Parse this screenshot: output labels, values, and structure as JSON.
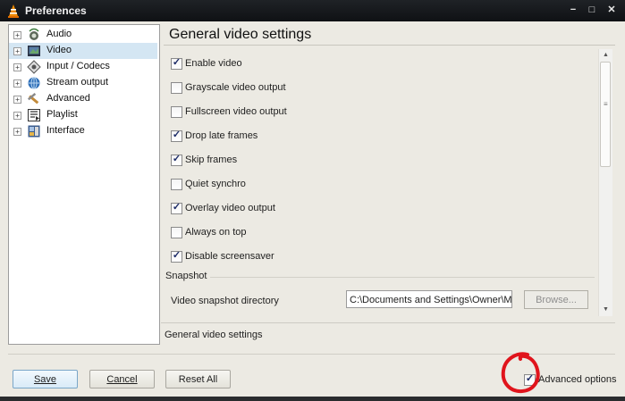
{
  "window": {
    "title": "Preferences",
    "controls": {
      "minimize": "−",
      "maximize": "□",
      "close": "✕"
    }
  },
  "tree": {
    "items": [
      {
        "label": "Audio",
        "icon": "audio-icon",
        "expander": "+"
      },
      {
        "label": "Video",
        "icon": "video-icon",
        "expander": "+",
        "selected": true
      },
      {
        "label": "Input / Codecs",
        "icon": "input-codecs-icon",
        "expander": "+"
      },
      {
        "label": "Stream output",
        "icon": "stream-output-icon",
        "expander": "+"
      },
      {
        "label": "Advanced",
        "icon": "advanced-icon",
        "expander": "+"
      },
      {
        "label": "Playlist",
        "icon": "playlist-icon",
        "expander": "+"
      },
      {
        "label": "Interface",
        "icon": "interface-icon",
        "expander": "+"
      }
    ]
  },
  "panel": {
    "title": "General video settings",
    "options": [
      {
        "label": "Enable video",
        "checked": true
      },
      {
        "label": "Grayscale video output",
        "checked": false
      },
      {
        "label": "Fullscreen video output",
        "checked": false
      },
      {
        "label": "Drop late frames",
        "checked": true
      },
      {
        "label": "Skip frames",
        "checked": true
      },
      {
        "label": "Quiet synchro",
        "checked": false
      },
      {
        "label": "Overlay video output",
        "checked": true
      },
      {
        "label": "Always on top",
        "checked": false
      },
      {
        "label": "Disable screensaver",
        "checked": true
      }
    ],
    "snapshot": {
      "section_label": "Snapshot",
      "dir_label": "Video snapshot directory",
      "dir_value": "C:\\Documents and Settings\\Owner\\My",
      "browse_label": "Browse..."
    },
    "status": "General video settings"
  },
  "footer": {
    "save_label": "Save",
    "cancel_label": "Cancel",
    "reset_label": "Reset All",
    "advanced_options_label": "Advanced options",
    "advanced_options_checked": true
  },
  "colors": {
    "titlebar": "#16191c",
    "selection": "#d4e6f3",
    "annotation_circle": "#e0141c",
    "window_bg": "#eceae3"
  }
}
